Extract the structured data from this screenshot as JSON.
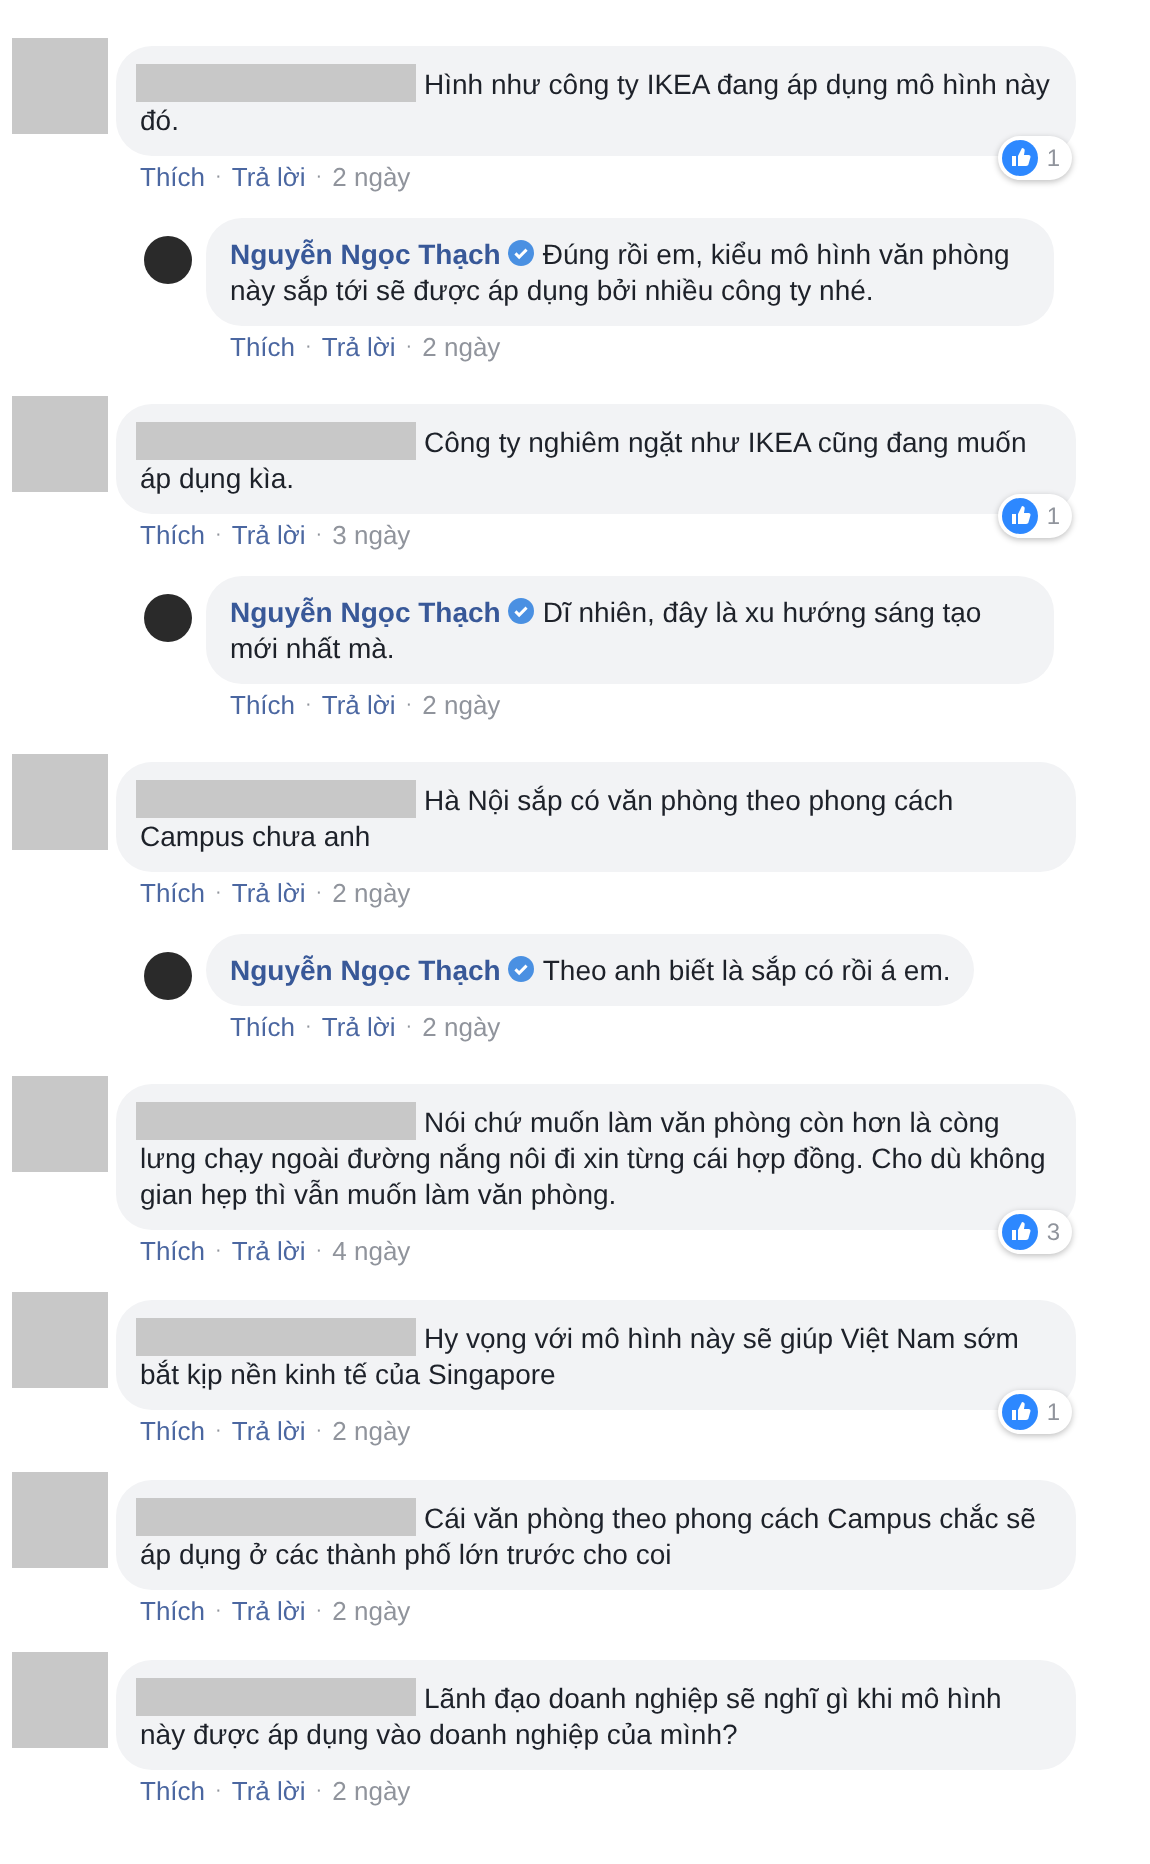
{
  "comments": [
    {
      "kind": "user",
      "text": "Hình như công ty IKEA đang áp dụng mô hình này đó.",
      "reactions": "1",
      "separator": "·",
      "actions": [
        {
          "kind": "like",
          "label": "Thích"
        },
        {
          "kind": "reply",
          "label": "Trả lời"
        },
        {
          "kind": "time",
          "label": "2 ngày"
        }
      ]
    },
    {
      "kind": "author",
      "name": "Nguyễn Ngọc Thạch",
      "verified": true,
      "text": "Đúng rồi em, kiểu mô hình văn phòng này sắp tới sẽ được áp dụng bởi nhiều công ty nhé.",
      "separator": "·",
      "actions": [
        {
          "kind": "like",
          "label": "Thích"
        },
        {
          "kind": "reply",
          "label": "Trả lời"
        },
        {
          "kind": "time",
          "label": "2 ngày"
        }
      ]
    },
    {
      "kind": "user",
      "text": "Công ty nghiêm ngặt như IKEA cũng đang muốn áp dụng kìa.",
      "reactions": "1",
      "separator": "·",
      "actions": [
        {
          "kind": "like",
          "label": "Thích"
        },
        {
          "kind": "reply",
          "label": "Trả lời"
        },
        {
          "kind": "time",
          "label": "3 ngày"
        }
      ]
    },
    {
      "kind": "author",
      "name": "Nguyễn Ngọc Thạch",
      "verified": true,
      "text": "Dĩ nhiên, đây là xu hướng sáng tạo mới nhất mà.",
      "separator": "·",
      "actions": [
        {
          "kind": "like",
          "label": "Thích"
        },
        {
          "kind": "reply",
          "label": "Trả lời"
        },
        {
          "kind": "time",
          "label": "2 ngày"
        }
      ]
    },
    {
      "kind": "user",
      "text": "Hà Nội sắp có văn phòng theo phong cách Campus chưa anh",
      "separator": "·",
      "actions": [
        {
          "kind": "like",
          "label": "Thích"
        },
        {
          "kind": "reply",
          "label": "Trả lời"
        },
        {
          "kind": "time",
          "label": "2 ngày"
        }
      ]
    },
    {
      "kind": "author",
      "name": "Nguyễn Ngọc Thạch",
      "verified": true,
      "text": "Theo anh biết là sắp có rồi á em.",
      "separator": "·",
      "actions": [
        {
          "kind": "like",
          "label": "Thích"
        },
        {
          "kind": "reply",
          "label": "Trả lời"
        },
        {
          "kind": "time",
          "label": "2 ngày"
        }
      ]
    },
    {
      "kind": "user",
      "text": "Nói chứ muốn làm văn phòng còn hơn là còng lưng chạy ngoài đường nắng nôi đi xin từng cái hợp đồng. Cho dù không gian hẹp thì vẫn muốn làm văn phòng.",
      "reactions": "3",
      "separator": "·",
      "actions": [
        {
          "kind": "like",
          "label": "Thích"
        },
        {
          "kind": "reply",
          "label": "Trả lời"
        },
        {
          "kind": "time",
          "label": "4 ngày"
        }
      ]
    },
    {
      "kind": "user",
      "text": "Hy vọng với mô hình này sẽ giúp Việt Nam sớm bắt kịp nền kinh tế của Singapore",
      "reactions": "1",
      "separator": "·",
      "actions": [
        {
          "kind": "like",
          "label": "Thích"
        },
        {
          "kind": "reply",
          "label": "Trả lời"
        },
        {
          "kind": "time",
          "label": "2 ngày"
        }
      ]
    },
    {
      "kind": "user",
      "text": "Cái văn phòng theo phong cách Campus chắc sẽ áp dụng ở các thành phố lớn trước cho coi",
      "separator": "·",
      "actions": [
        {
          "kind": "like",
          "label": "Thích"
        },
        {
          "kind": "reply",
          "label": "Trả lời"
        },
        {
          "kind": "time",
          "label": "2 ngày"
        }
      ]
    },
    {
      "kind": "user",
      "text": "Lãnh đạo doanh nghiệp sẽ nghĩ gì khi mô hình này được áp dụng vào doanh nghiệp của mình?",
      "separator": "·",
      "actions": [
        {
          "kind": "like",
          "label": "Thích"
        },
        {
          "kind": "reply",
          "label": "Trả lời"
        },
        {
          "kind": "time",
          "label": "2 ngày"
        }
      ]
    }
  ]
}
